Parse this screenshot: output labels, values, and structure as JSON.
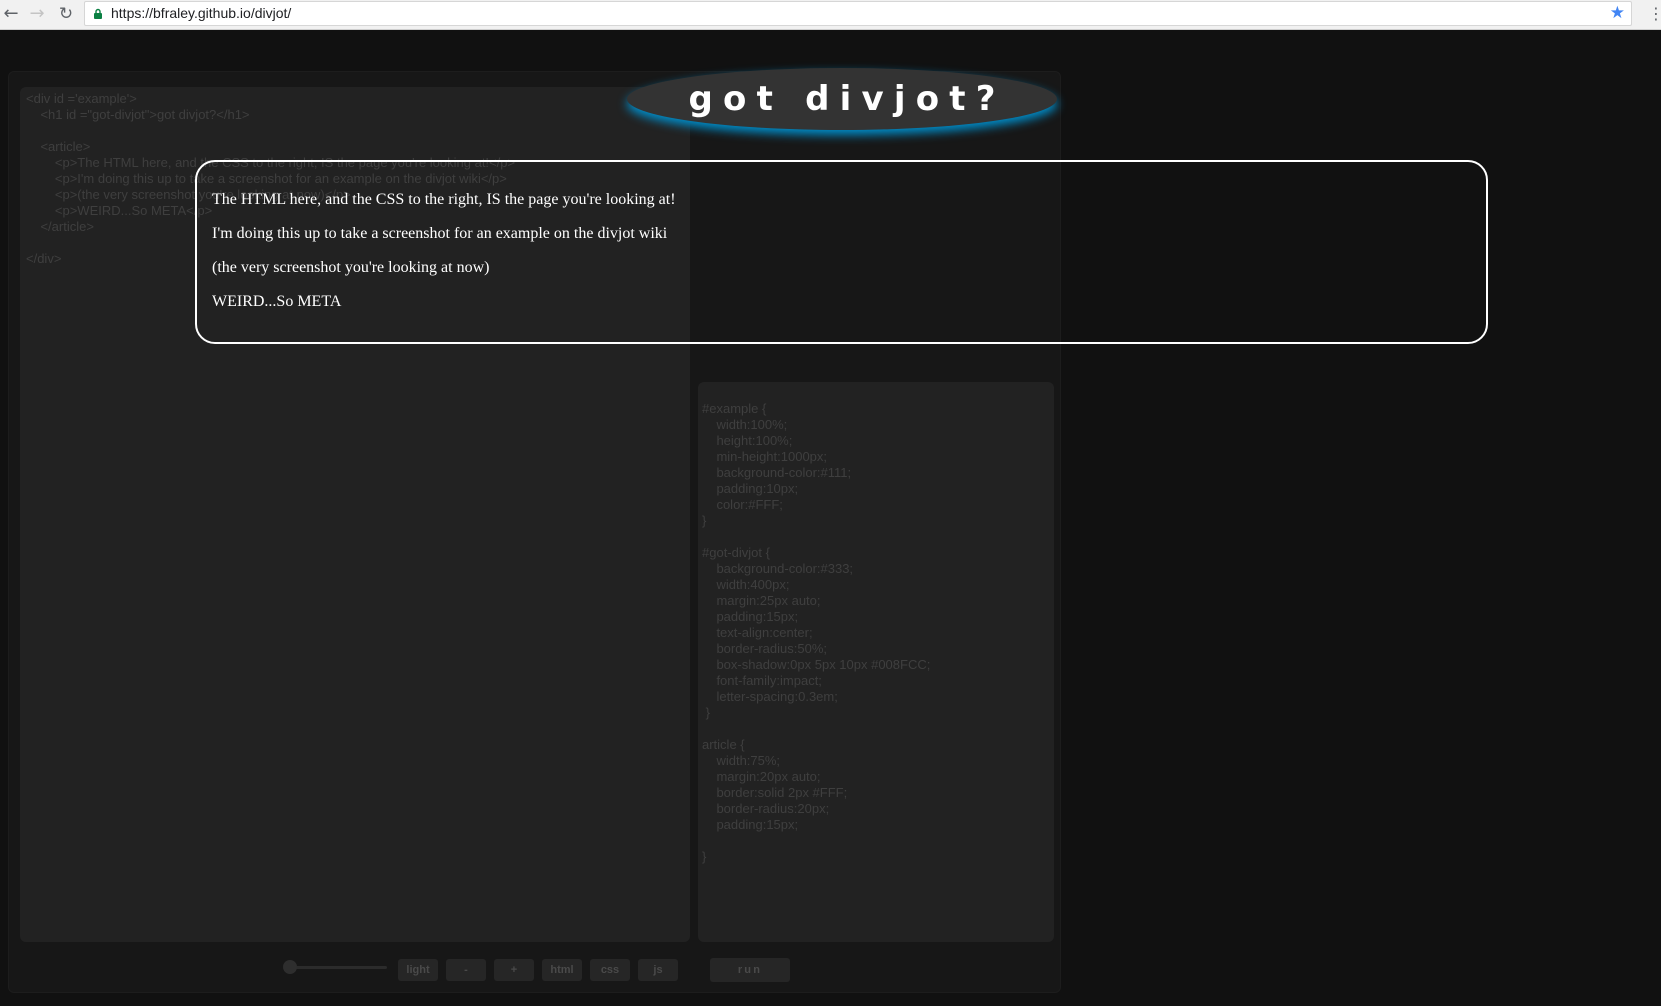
{
  "browser": {
    "url": "https://bfraley.github.io/divjot/",
    "back_glyph": "←",
    "forward_glyph": "→",
    "reload_glyph": "↻",
    "star_glyph": "★",
    "menu_glyph": "⋮",
    "accent_color": "#4285f4"
  },
  "editors": {
    "html_code": "<div id ='example'>\n    <h1 id =\"got-divjot\">got divjot?</h1>\n\n    <article>\n        <p>The HTML here, and the CSS to the right, IS the page you're looking at!</p>\n        <p>I'm doing this up to take a screenshot for an example on the divjot wiki</p>\n        <p>(the very screenshot you're looking at now)</p>\n        <p>WEIRD...So META</p>\n    </article>\n\n</div>",
    "css_code": "#example {\n    width:100%;\n    height:100%;\n    min-height:1000px;\n    background-color:#111;\n    padding:10px;\n    color:#FFF;\n}\n\n#got-divjot {\n    background-color:#333;\n    width:400px;\n    margin:25px auto;\n    padding:15px;\n    text-align:center;\n    border-radius:50%;\n    box-shadow:0px 5px 10px #008FCC;\n    font-family:impact;\n    letter-spacing:0.3em;\n }\n\narticle {\n    width:75%;\n    margin:20px auto;\n    border:solid 2px #FFF;\n    border-radius:20px;\n    padding:15px;\n\n}"
  },
  "preview": {
    "heading": "got divjot?",
    "paragraphs": [
      "The HTML here, and the CSS to the right, IS the page you're looking at!",
      "I'm doing this up to take a screenshot for an example on the divjot wiki",
      "(the very screenshot you're looking at now)",
      "WEIRD...So META"
    ],
    "shadow_color": "#008FCC"
  },
  "controls": {
    "light_label": "light",
    "minus_label": "-",
    "plus_label": "+",
    "html_label": "html",
    "css_label": "css",
    "js_label": "js",
    "run_label": "run"
  }
}
